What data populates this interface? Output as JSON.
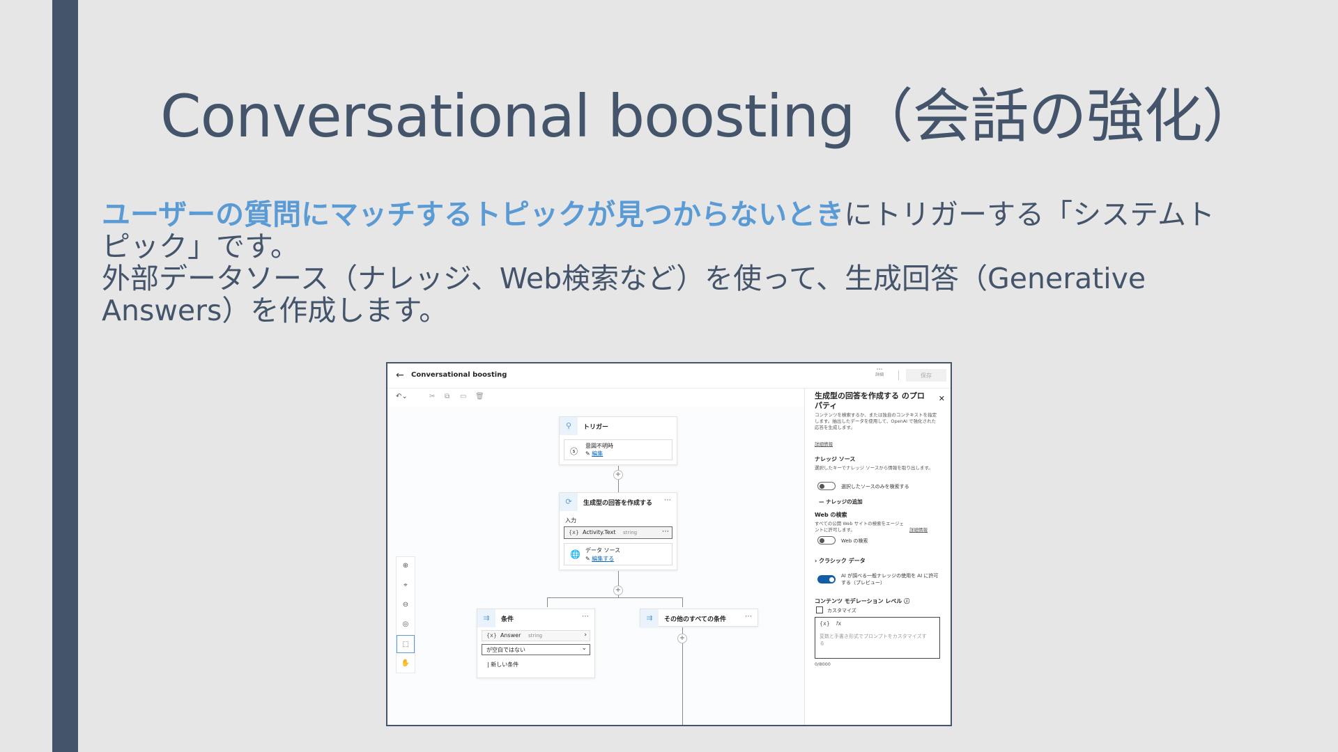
{
  "slide": {
    "title": "Conversational boosting（会話の強化）",
    "line1_highlight": "ユーザーの質問にマッチするトピックが見つからないとき",
    "line1_rest": "にトリガーする「システムトピック」です。",
    "line2": "外部データソース（ナレッジ、Web検索など）を使って、生成回答（Generative Answers）を作成します。"
  },
  "app": {
    "title": "Conversational boosting",
    "more_label": "詳細",
    "save_label": "保存"
  },
  "canvas": {
    "trigger_node": {
      "title": "トリガー",
      "item": "意図不明時",
      "edit_link": "編集"
    },
    "gen_node": {
      "title": "生成型の回答を作成する",
      "input_label": "入力",
      "var_name": "Activity.Text",
      "var_type": "string",
      "datasource_label": "データ ソース",
      "datasource_link": "編集する"
    },
    "condition_node": {
      "title": "条件",
      "var_name": "Answer",
      "var_type": "string",
      "operator": "が空白ではない",
      "new_condition": "新しい条件"
    },
    "other_node": {
      "title": "その他のすべての条件"
    }
  },
  "panel": {
    "title": "生成型の回答を作成する のプロパティ",
    "desc": "コンテンツを検索するか、または独自のコンテキストを指定します。抽出したデータを使用して、OpenAI で強化された応答を生成します。",
    "details_link": "詳細情報",
    "knowledge_head": "ナレッジ ソース",
    "knowledge_desc": "選択したキーでナレッジ ソースから情報を取り出します。",
    "knowledge_toggle": "選択したソースのみを検索する",
    "add_knowledge": "ナレッジの追加",
    "web_head": "Web の検索",
    "web_desc": "すべての公開 Web サイトの検索をエージェントに許可します。",
    "web_link": "詳細情報",
    "web_toggle": "Web の検索",
    "classic_head": "クラシック データ",
    "ai_toggle": "AI が調べる一般ナレッジの使用を AI に許可する（プレビュー）",
    "moderation_head": "コンテンツ モデレーション レベル",
    "customize": "カスタマイズ",
    "prompt_placeholder": "変数と手書き形式でプロンプトをカスタマイズする",
    "char_count": "0/8000"
  },
  "colors": {
    "accent": "#5b9bd5",
    "sidebar": "#44546a",
    "background": "#e6e6e6"
  }
}
